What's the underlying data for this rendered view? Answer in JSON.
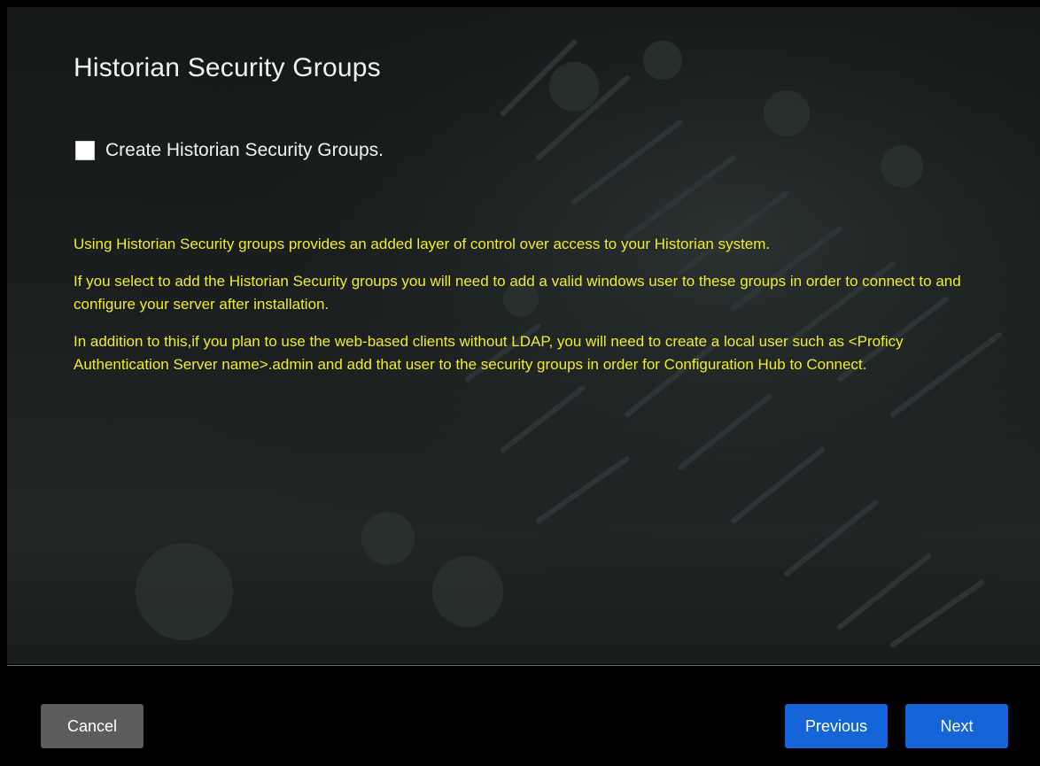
{
  "page": {
    "title": "Historian Security Groups"
  },
  "option": {
    "checkbox_label": "Create Historian Security Groups.",
    "checked": false
  },
  "info": {
    "paragraphs": [
      "Using Historian Security groups provides an added layer of control over access to your Historian system.",
      "If you select to add the Historian Security groups you will need to add a valid windows user to these groups in order to connect to and configure your server after installation.",
      "In addition to this,if you plan to use the web-based clients without LDAP, you will need to create a local user such as <Proficy Authentication Server name>.admin and add that user to the security groups in order for Configuration Hub to Connect."
    ]
  },
  "footer": {
    "cancel_label": "Cancel",
    "previous_label": "Previous",
    "next_label": "Next"
  },
  "colors": {
    "info_text": "#f1ed2a",
    "primary_button": "#1565d8",
    "secondary_button": "#5c5c5c"
  }
}
